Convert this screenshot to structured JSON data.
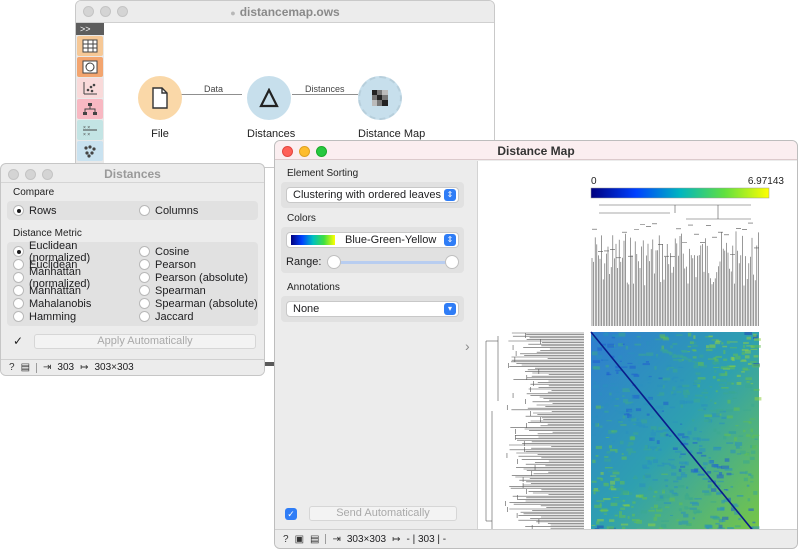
{
  "canvas": {
    "title": "distancemap.ows",
    "toolbox_expand": ">>",
    "tools": [
      {
        "icon": "data-table-icon",
        "color": "#f6c896"
      },
      {
        "icon": "transform-icon",
        "color": "#f3a56f"
      },
      {
        "icon": "scatter-plot-icon",
        "color": "#f9dada"
      },
      {
        "icon": "tree-icon",
        "color": "#f8b8c2"
      },
      {
        "icon": "distances-grid-icon",
        "color": "#c3e4e4"
      },
      {
        "icon": "cluster-icon",
        "color": "#c9e2f0"
      }
    ],
    "nodes": [
      {
        "label": "File",
        "icon": "file-icon",
        "color": "#fad8a8"
      },
      {
        "label": "Distances",
        "icon": "delta-icon",
        "color": "#c7dfec"
      },
      {
        "label": "Distance Map",
        "icon": "distance-map-icon",
        "color": "#c7dfec"
      }
    ],
    "links": [
      {
        "label": "Data"
      },
      {
        "label": "Distances"
      }
    ]
  },
  "distances": {
    "title": "Distances",
    "compare_label": "Compare",
    "compare_options": [
      "Rows",
      "Columns"
    ],
    "compare_selected": "Rows",
    "metric_label": "Distance Metric",
    "metrics_left": [
      "Euclidean (normalized)",
      "Euclidean",
      "Manhattan (normalized)",
      "Manhattan",
      "Mahalanobis",
      "Hamming"
    ],
    "metrics_right": [
      "Cosine",
      "Pearson",
      "Pearson (absolute)",
      "Spearman",
      "Spearman (absolute)",
      "Jaccard"
    ],
    "metric_selected": "Euclidean (normalized)",
    "apply_label": "Apply Automatically",
    "status_in": "303",
    "status_out": "303×303"
  },
  "distance_map": {
    "title": "Distance Map",
    "sorting_label": "Element Sorting",
    "sorting_value": "Clustering with ordered leaves",
    "colors_label": "Colors",
    "colors_value": "Blue-Green-Yellow",
    "range_label": "Range:",
    "range_low": 0,
    "range_high": 1,
    "annotations_label": "Annotations",
    "annotations_value": "None",
    "send_label": "Send Automatically",
    "legend_min": "0",
    "legend_max": "6.97143",
    "status_in": "303×303",
    "status_out": "- | 303 | -"
  },
  "colors": {
    "accent": "#2f7df6",
    "gradient": [
      "#00007f",
      "#0040ff",
      "#00c0c0",
      "#40e040",
      "#ffff00"
    ]
  }
}
